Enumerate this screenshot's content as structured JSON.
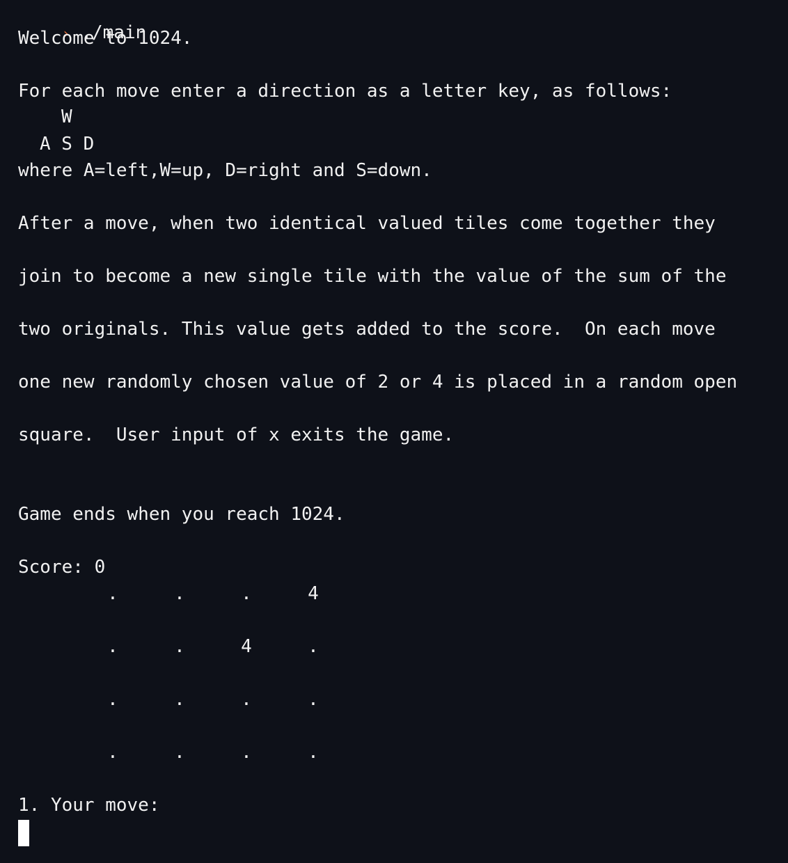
{
  "terminal": {
    "prompt_symbol": "›",
    "command": "./main",
    "welcome": "Welcome to 1024.",
    "instructions_intro": "For each move enter a direction as a letter key, as follows:",
    "key_up": "W",
    "keys_row": "A S D",
    "key_legend": "where A=left,W=up, D=right and S=down.",
    "rules": [
      "After a move, when two identical valued tiles come together they",
      "join to become a new single tile with the value of the sum of the",
      "two originals. This value gets added to the score.  On each move",
      "one new randomly chosen value of 2 or 4 is placed in a random open",
      "square.  User input of x exits the game."
    ],
    "game_end": "Game ends when you reach 1024.",
    "score_line": "Score: 0",
    "board": [
      [
        ".",
        ".",
        ".",
        "4"
      ],
      [
        ".",
        ".",
        "4",
        "."
      ],
      [
        ".",
        ".",
        ".",
        "."
      ],
      [
        ".",
        ".",
        ".",
        "."
      ]
    ],
    "move_prompt": "1. Your move:"
  }
}
